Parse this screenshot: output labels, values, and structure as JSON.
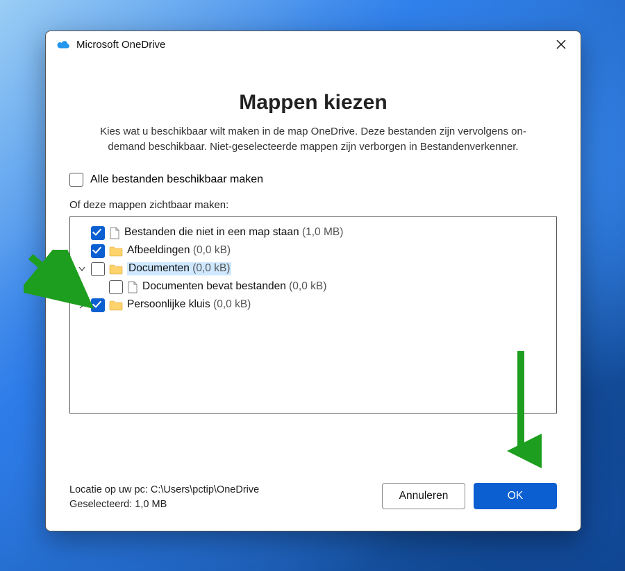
{
  "window": {
    "title": "Microsoft OneDrive"
  },
  "heading": "Mappen kiezen",
  "subheading": "Kies wat u beschikbaar wilt maken in de map OneDrive. Deze bestanden zijn vervolgens on-demand beschikbaar. Niet-geselecteerde mappen zijn verborgen in Bestandenverkenner.",
  "all_files_label": "Alle bestanden beschikbaar maken",
  "section_label": "Of deze mappen zichtbaar maken:",
  "tree": [
    {
      "checked": true,
      "icon": "file",
      "label": "Bestanden die niet in een map staan",
      "size": "(1,0 MB)",
      "indent": 0,
      "expander": "none",
      "selected": false
    },
    {
      "checked": true,
      "icon": "folder",
      "label": "Afbeeldingen",
      "size": "(0,0 kB)",
      "indent": 0,
      "expander": "none",
      "selected": false
    },
    {
      "checked": false,
      "icon": "folder",
      "label": "Documenten",
      "size": "(0,0 kB)",
      "indent": 0,
      "expander": "down",
      "selected": true
    },
    {
      "checked": false,
      "icon": "file",
      "label": "Documenten bevat bestanden",
      "size": "(0,0 kB)",
      "indent": 1,
      "expander": "none",
      "selected": false
    },
    {
      "checked": true,
      "icon": "folder",
      "label": "Persoonlijke kluis",
      "size": "(0,0 kB)",
      "indent": 0,
      "expander": "right",
      "selected": false
    }
  ],
  "footer": {
    "location_label": "Locatie op uw pc: C:\\Users\\pctip\\OneDrive",
    "selected_label": "Geselecteerd: 1,0 MB",
    "cancel": "Annuleren",
    "ok": "OK"
  }
}
